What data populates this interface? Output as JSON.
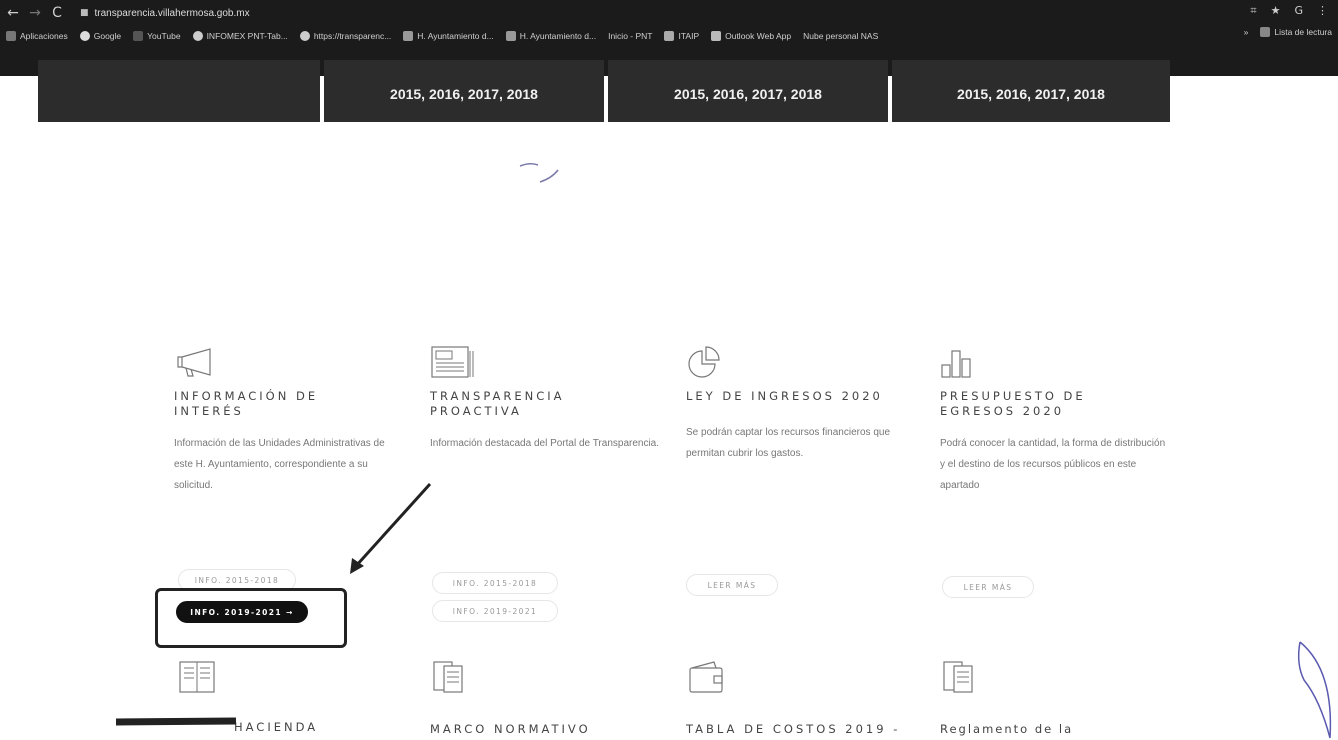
{
  "browser": {
    "url": "transparencia.villahermosa.gob.mx",
    "bookmarks": [
      "Aplicaciones",
      "Google",
      "YouTube",
      "INFOMEX PNT-Tab...",
      "https://transparenc...",
      "H. Ayuntamiento d...",
      "H. Ayuntamiento d...",
      "Inicio - PNT",
      "ITAIP",
      "Outlook Web App",
      "Nube personal NAS"
    ],
    "reading_list": "Lista de lectura"
  },
  "banners": [
    "2015, 2016, 2017, 2018",
    "2015, 2016, 2017, 2018",
    "2015, 2016, 2017, 2018"
  ],
  "cards": [
    {
      "title": "INFORMACIÓN DE\nINTERÉS",
      "desc": "Información de las Unidades Administrativas de este H. Ayuntamiento, correspondiente a su solicitud.",
      "buttons": [
        "INFO. 2015-2018",
        "INFO. 2019-2021 →"
      ]
    },
    {
      "title": "TRANSPARENCIA\nPROACTIVA",
      "desc": "Información destacada del Portal de Transparencia.",
      "buttons": [
        "INFO. 2015-2018",
        "INFO. 2019-2021"
      ]
    },
    {
      "title": "LEY DE INGRESOS 2020",
      "desc": "Se podrán captar los recursos financieros que permitan cubrir los gastos.",
      "buttons": [
        "LEER MÁS"
      ]
    },
    {
      "title": "PRESUPUESTO DE\nEGRESOS 2020",
      "desc": "Podrá conocer la cantidad, la forma de distribución y el destino de los recursos públicos en este apartado",
      "buttons": [
        "LEER MÁS"
      ]
    }
  ],
  "bottom_titles": [
    "HACIENDA",
    "MARCO NORMATIVO",
    "TABLA DE COSTOS 2019 -",
    "Reglamento de la"
  ],
  "colors": {
    "banner": "#2c2c2c",
    "chrome": "#1b1b1b",
    "active_button": "#111111"
  }
}
